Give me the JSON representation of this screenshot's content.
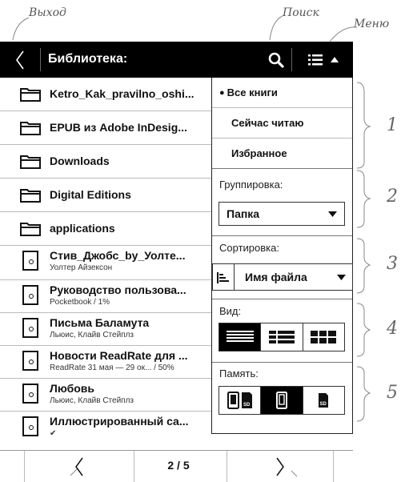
{
  "callouts": {
    "exit": "Выход",
    "search": "Поиск",
    "menu": "Меню"
  },
  "numbers": [
    "1",
    "2",
    "3",
    "4",
    "5"
  ],
  "header": {
    "title": "Библиотека:",
    "back_icon": "chevron-left-icon",
    "search_icon": "search-icon",
    "menu_icon": "menu-list-icon",
    "collapse_icon": "triangle-up-icon"
  },
  "folders": [
    {
      "title": "Ketro_Kak_pravilno_oshi..."
    },
    {
      "title": "EPUB из Adobe InDesig..."
    },
    {
      "title": "Downloads"
    },
    {
      "title": "Digital Editions"
    },
    {
      "title": "applications"
    }
  ],
  "books": [
    {
      "title": "Стив_Джобс_by_Уолте...",
      "sub": "Уолтер Айзексон"
    },
    {
      "title": "Руководство пользова...",
      "sub": "Pocketbook / 1%"
    },
    {
      "title": "Письма Баламута",
      "sub": "Льюис, Клайв Стейплз"
    },
    {
      "title": "Новости ReadRate для ...",
      "sub": "ReadRate 31 мая — 29 ок... / 50%"
    },
    {
      "title": "Любовь",
      "sub": "Льюис, Клайв Стейплз"
    },
    {
      "title": "Иллюстрированный са...",
      "sub": "✔"
    }
  ],
  "panel": {
    "filter": {
      "all": "Все книги",
      "reading": "Сейчас читаю",
      "favorites": "Избранное",
      "selected": "all"
    },
    "grouping": {
      "label": "Группировка:",
      "value": "Папка"
    },
    "sorting": {
      "label": "Сортировка:",
      "value": "Имя файла"
    },
    "view": {
      "label": "Вид:",
      "options": [
        "list-detailed-icon",
        "list-thumbnails-icon",
        "grid-icon"
      ],
      "selected": 0
    },
    "memory": {
      "label": "Память:",
      "options": [
        "device-and-sd-icon",
        "device-icon",
        "sd-card-icon"
      ],
      "selected": 1
    }
  },
  "footer": {
    "page": "2 / 5",
    "prev_icon": "chevron-left-icon",
    "next_icon": "chevron-right-icon"
  }
}
